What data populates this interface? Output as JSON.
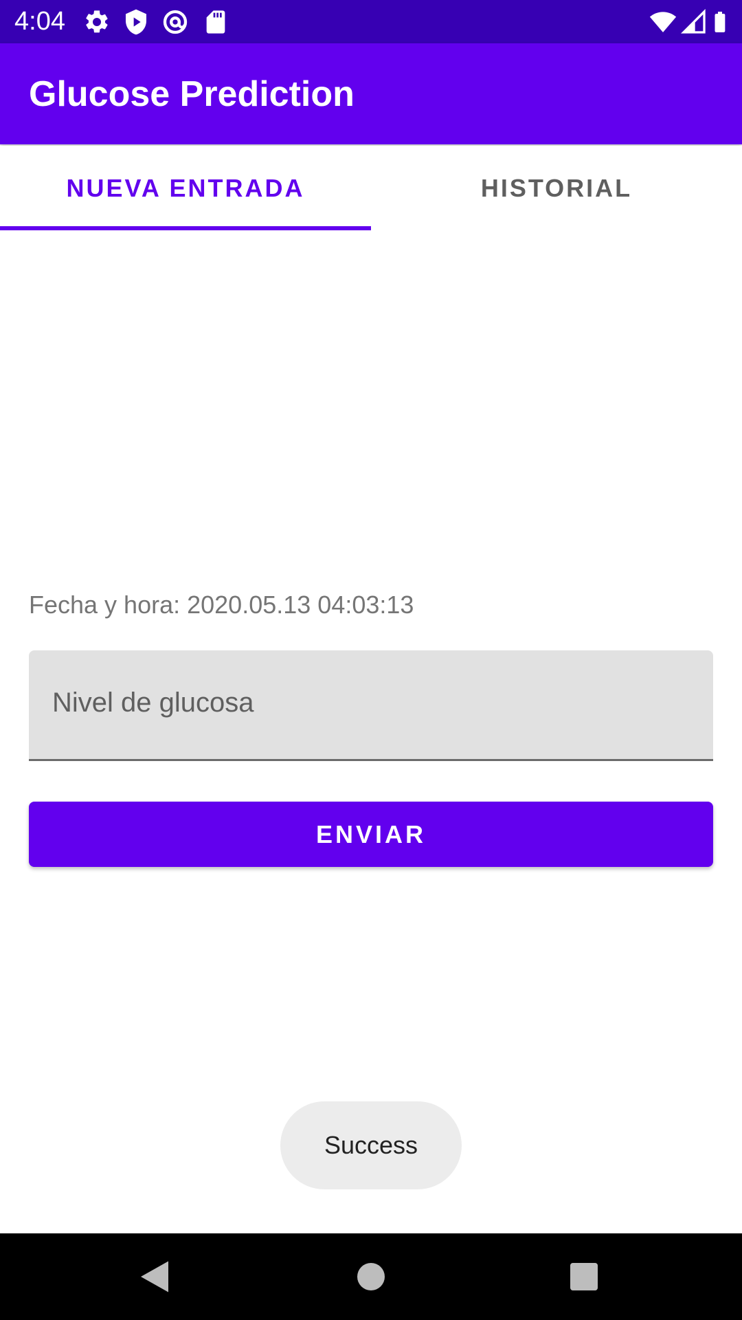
{
  "status_bar": {
    "time": "4:04",
    "left_icons": [
      "gear-icon",
      "shield-play-icon",
      "at-sign-icon",
      "sd-card-icon"
    ],
    "right_icons": [
      "wifi-icon",
      "signal-icon",
      "battery-icon"
    ]
  },
  "app_bar": {
    "title": "Glucose Prediction"
  },
  "tabs": [
    {
      "label": "NUEVA ENTRADA",
      "selected": true
    },
    {
      "label": "HISTORIAL",
      "selected": false
    }
  ],
  "form": {
    "datetime_text": "Fecha y hora: 2020.05.13 04:03:13",
    "glucose_placeholder": "Nivel de glucosa",
    "glucose_value": "",
    "submit_label": "ENVIAR"
  },
  "toast": {
    "text": "Success"
  },
  "nav_bar": {
    "buttons": [
      "back-icon",
      "home-icon",
      "recents-icon"
    ]
  },
  "colors": {
    "primary": "#6200ee",
    "primary_dark": "#3700b3",
    "input_background": "#e1e1e1",
    "toast_background": "#ececec"
  }
}
